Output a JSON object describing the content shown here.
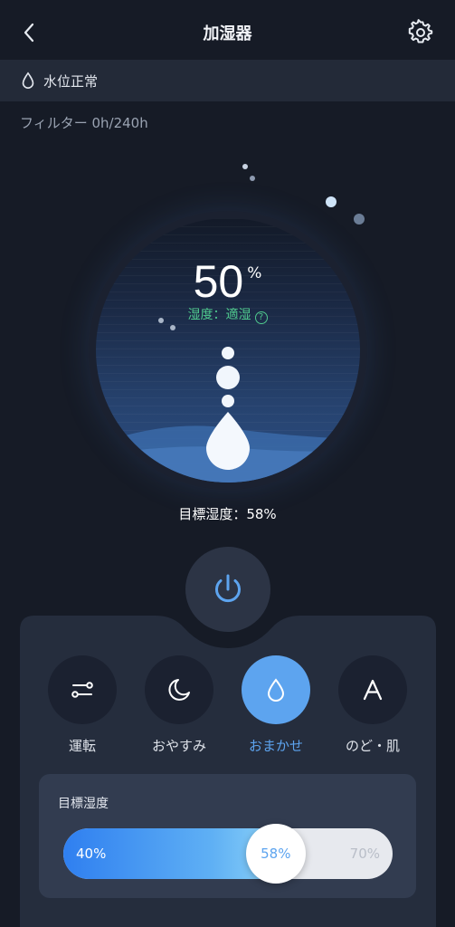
{
  "header": {
    "title": "加湿器",
    "back_icon": "chevron-left-icon",
    "settings_icon": "gear-icon"
  },
  "status_bar": {
    "icon": "water-drop-icon",
    "text": "水位正常"
  },
  "filter": {
    "text": "フィルター 0h/240h"
  },
  "dial": {
    "humidity_value": "50",
    "humidity_unit": "%",
    "status_text": "湿度：適湿",
    "help_icon": "question-circle-icon",
    "status_color": "#4fc98e"
  },
  "target_text": "目標湿度：58%",
  "power": {
    "icon": "power-icon",
    "color": "#5da4ef"
  },
  "modes": [
    {
      "label": "運転",
      "icon": "sliders-icon",
      "active": false
    },
    {
      "label": "おやすみ",
      "icon": "moon-icon",
      "active": false
    },
    {
      "label": "おまかせ",
      "icon": "water-drop-icon",
      "active": true
    },
    {
      "label": "のど・肌",
      "icon": "letter-a-icon",
      "active": false
    }
  ],
  "target_card": {
    "label": "目標湿度",
    "min_label": "40%",
    "max_label": "70%",
    "value_label": "58%",
    "value": 58,
    "min": 40,
    "max": 70
  },
  "colors": {
    "accent": "#5da4ef",
    "background": "#161b26",
    "panel": "#252d3d"
  }
}
